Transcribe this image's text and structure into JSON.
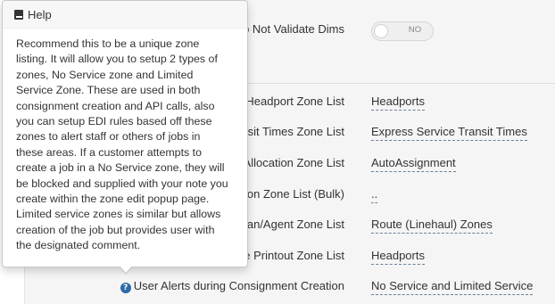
{
  "popover": {
    "title": "Help",
    "lines": [
      "Recommend this to be a unique zone",
      "listing. It will allow you to setup 2 types of",
      "zones, No Service zone and Limited",
      "Service Zone. These are used in both",
      "consignment creation and API calls, also",
      "you can setup EDI rules based off these",
      "zones to alert staff or others of jobs in",
      "these areas.  If a customer attempts to",
      "create a job in a No Service zone, they will",
      "be blocked and supplied with your note you",
      "create within the zone edit popup page.",
      "Limited service zones is similar but allows",
      "creation of the job but provides user with",
      "the designated comment."
    ]
  },
  "toggle": {
    "label": "o Not Validate Dims",
    "state": "NO"
  },
  "rows": [
    {
      "label": "Headport Zone List",
      "value": "Headports"
    },
    {
      "label": "sit Times Zone List",
      "value": "Express Service Transit Times"
    },
    {
      "label": "Allocation Zone List",
      "value": "AutoAssignment"
    },
    {
      "label": "on Zone List (Bulk)",
      "value": ".."
    },
    {
      "label": "an/Agent Zone List",
      "value": "Route (Linehaul) Zones"
    },
    {
      "label": "e Printout Zone List",
      "value": "Headports"
    },
    {
      "label": "User Alerts during Consignment Creation",
      "value": "No Service and Limited Service"
    }
  ],
  "colors": {
    "panel_bg": "#f5f5f5",
    "help_icon": "#2c6aa8"
  }
}
